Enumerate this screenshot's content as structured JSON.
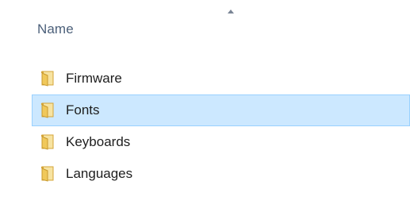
{
  "column_header": {
    "name_label": "Name",
    "sort_direction": "ascending"
  },
  "files": [
    {
      "name": "Firmware",
      "type": "folder",
      "selected": false
    },
    {
      "name": "Fonts",
      "type": "folder",
      "selected": true
    },
    {
      "name": "Keyboards",
      "type": "folder",
      "selected": false
    },
    {
      "name": "Languages",
      "type": "folder",
      "selected": false
    }
  ],
  "colors": {
    "selection_background": "#cce8ff",
    "selection_border": "#99d1ff",
    "header_text": "#4c607a",
    "folder_yellow": "#f0c85a"
  },
  "icons": {
    "folder": "folder-icon",
    "sort": "sort-ascending-icon"
  }
}
